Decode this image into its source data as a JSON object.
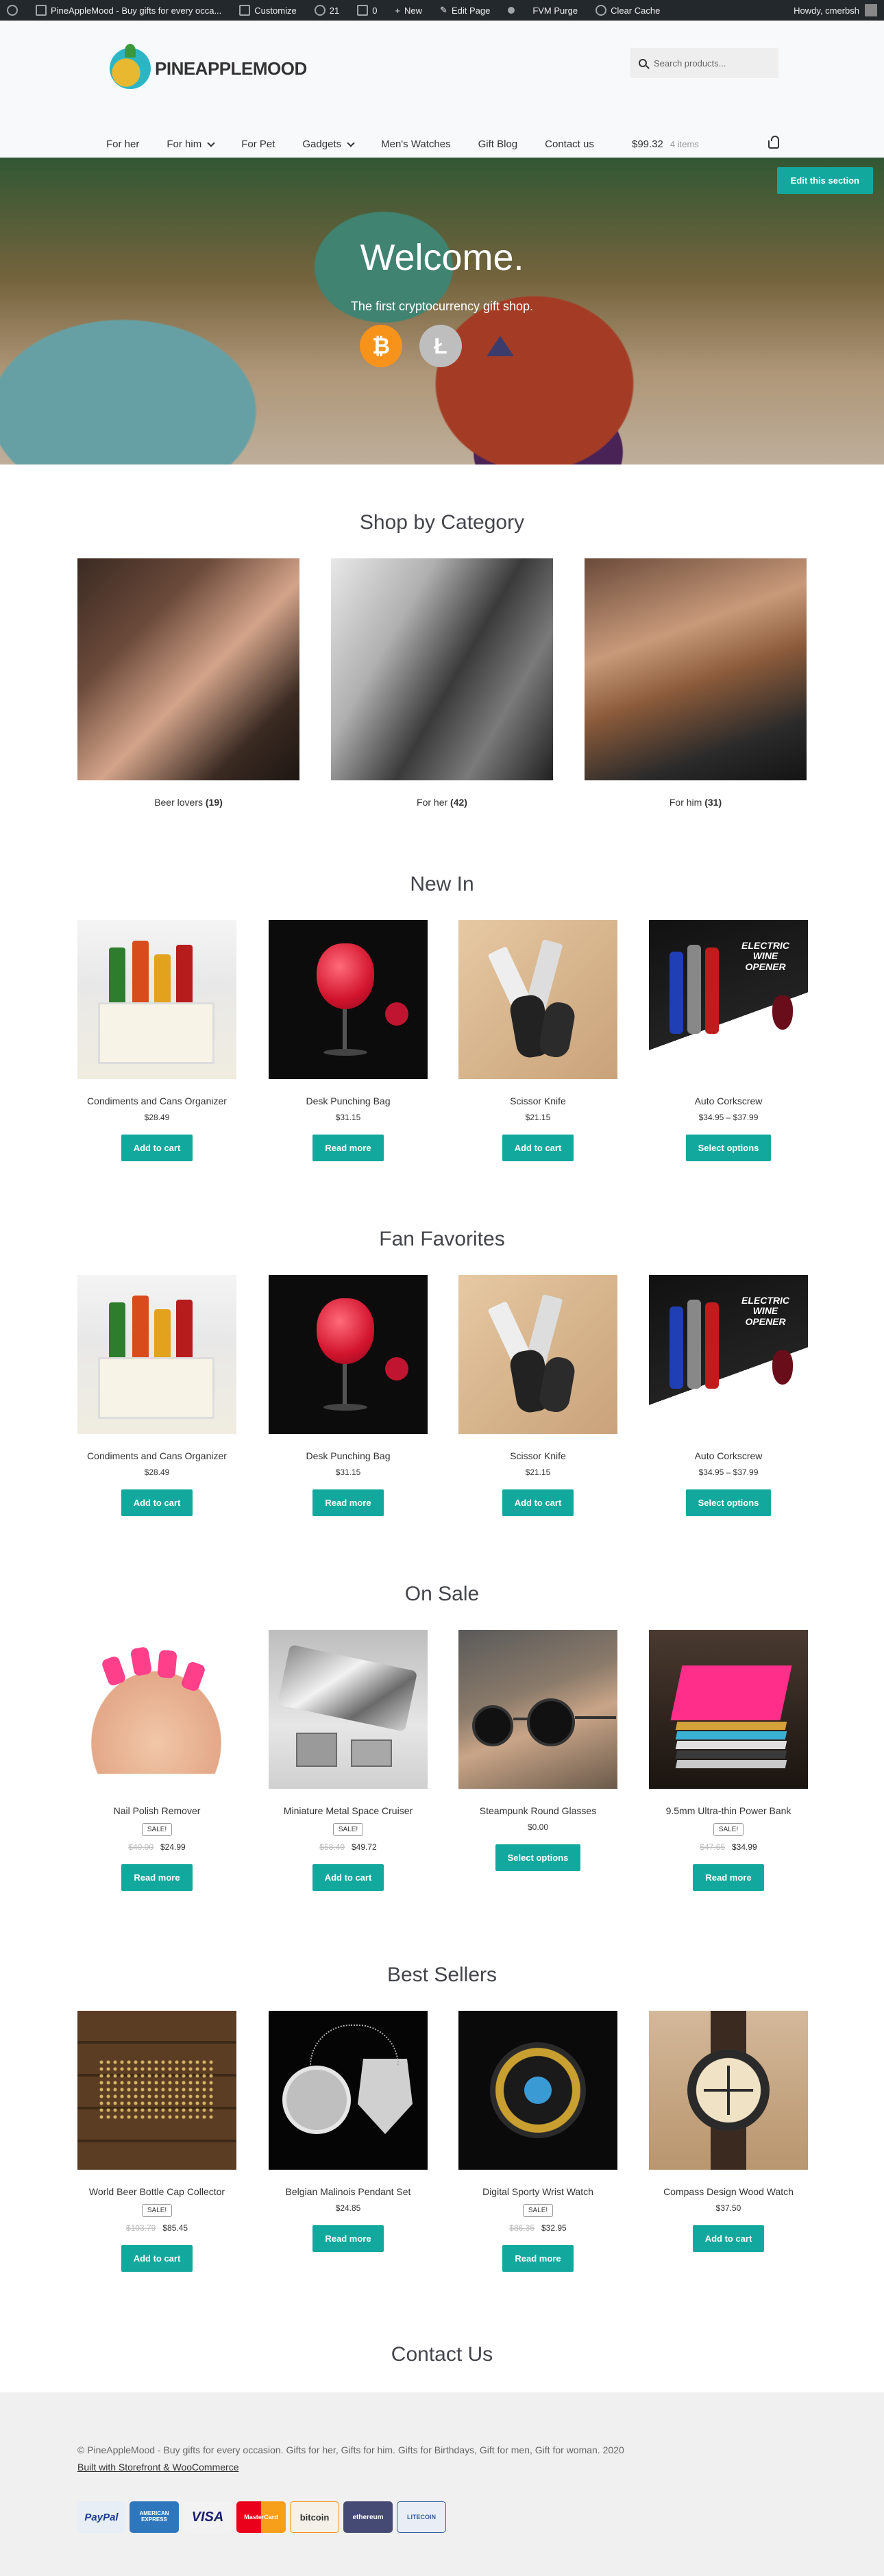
{
  "admin_bar": {
    "site": "PineAppleMood - Buy gifts for every occa...",
    "customize": "Customize",
    "updates": "21",
    "comments": "0",
    "new": "New",
    "edit_page": "Edit Page",
    "fvm": "FVM Purge",
    "clear_cache": "Clear Cache",
    "howdy": "Howdy, cmerbsh"
  },
  "header": {
    "logo_text": "PINEAPPLEMOOD",
    "search_placeholder": "Search products...",
    "nav": [
      "For her",
      "For him",
      "For Pet",
      "Gadgets",
      "Men's Watches",
      "Gift Blog",
      "Contact us"
    ],
    "cart_total": "$99.32",
    "cart_count": "4 items"
  },
  "hero": {
    "title": "Welcome.",
    "subtitle": "The first cryptocurrency gift shop.",
    "edit_button": "Edit this section",
    "coins": [
      "bitcoin-icon",
      "litecoin-icon",
      "ethereum-icon"
    ]
  },
  "categories": {
    "title": "Shop by Category",
    "items": [
      {
        "name": "Beer lovers",
        "count": "(19)"
      },
      {
        "name": "For her",
        "count": "(42)"
      },
      {
        "name": "For him",
        "count": "(31)"
      }
    ]
  },
  "new_in": {
    "title": "New In",
    "items": [
      {
        "name": "Condiments and Cans Organizer",
        "price": "$28.49",
        "button": "Add to cart"
      },
      {
        "name": "Desk Punching Bag",
        "price": "$31.15",
        "button": "Read more"
      },
      {
        "name": "Scissor Knife",
        "price": "$21.15",
        "button": "Add to cart"
      },
      {
        "name": "Auto Corkscrew",
        "price": "$34.95 – $37.99",
        "button": "Select options"
      }
    ]
  },
  "fan_favorites": {
    "title": "Fan Favorites",
    "items": [
      {
        "name": "Condiments and Cans Organizer",
        "price": "$28.49",
        "button": "Add to cart"
      },
      {
        "name": "Desk Punching Bag",
        "price": "$31.15",
        "button": "Read more"
      },
      {
        "name": "Scissor Knife",
        "price": "$21.15",
        "button": "Add to cart"
      },
      {
        "name": "Auto Corkscrew",
        "price": "$34.95 – $37.99",
        "button": "Select options"
      }
    ]
  },
  "on_sale": {
    "title": "On Sale",
    "sale_label": "Sale!",
    "items": [
      {
        "name": "Nail Polish Remover",
        "old_price": "$40.00",
        "price": "$24.99",
        "button": "Read more"
      },
      {
        "name": "Miniature Metal Space Cruiser",
        "old_price": "$58.40",
        "price": "$49.72",
        "button": "Add to cart"
      },
      {
        "name": "Steampunk Round Glasses",
        "price": "$0.00",
        "button": "Select options"
      },
      {
        "name": "9.5mm Ultra-thin Power Bank",
        "old_price": "$47.65",
        "price": "$34.99",
        "button": "Read more"
      }
    ]
  },
  "best_sellers": {
    "title": "Best Sellers",
    "items": [
      {
        "name": "World Beer Bottle Cap Collector",
        "old_price": "$103.79",
        "price": "$85.45",
        "button": "Add to cart"
      },
      {
        "name": "Belgian Malinois Pendant Set",
        "price": "$24.85",
        "button": "Read more"
      },
      {
        "name": "Digital Sporty Wrist Watch",
        "old_price": "$86.35",
        "price": "$32.95",
        "button": "Read more"
      },
      {
        "name": "Compass Design Wood Watch",
        "price": "$37.50",
        "button": "Add to cart"
      }
    ]
  },
  "contact": {
    "title": "Contact Us"
  },
  "footer": {
    "copyright": "© PineAppleMood - Buy gifts for every occasion. Gifts for her, Gifts for him. Gifts for Birthdays, Gift for men, Gift for woman. 2020",
    "built_with": "Built with Storefront & WooCommerce",
    "payments": [
      "PayPal",
      "AMERICAN EXPRESS",
      "VISA",
      "MasterCard",
      "bitcoin",
      "ethereum",
      "LITECOIN"
    ]
  }
}
